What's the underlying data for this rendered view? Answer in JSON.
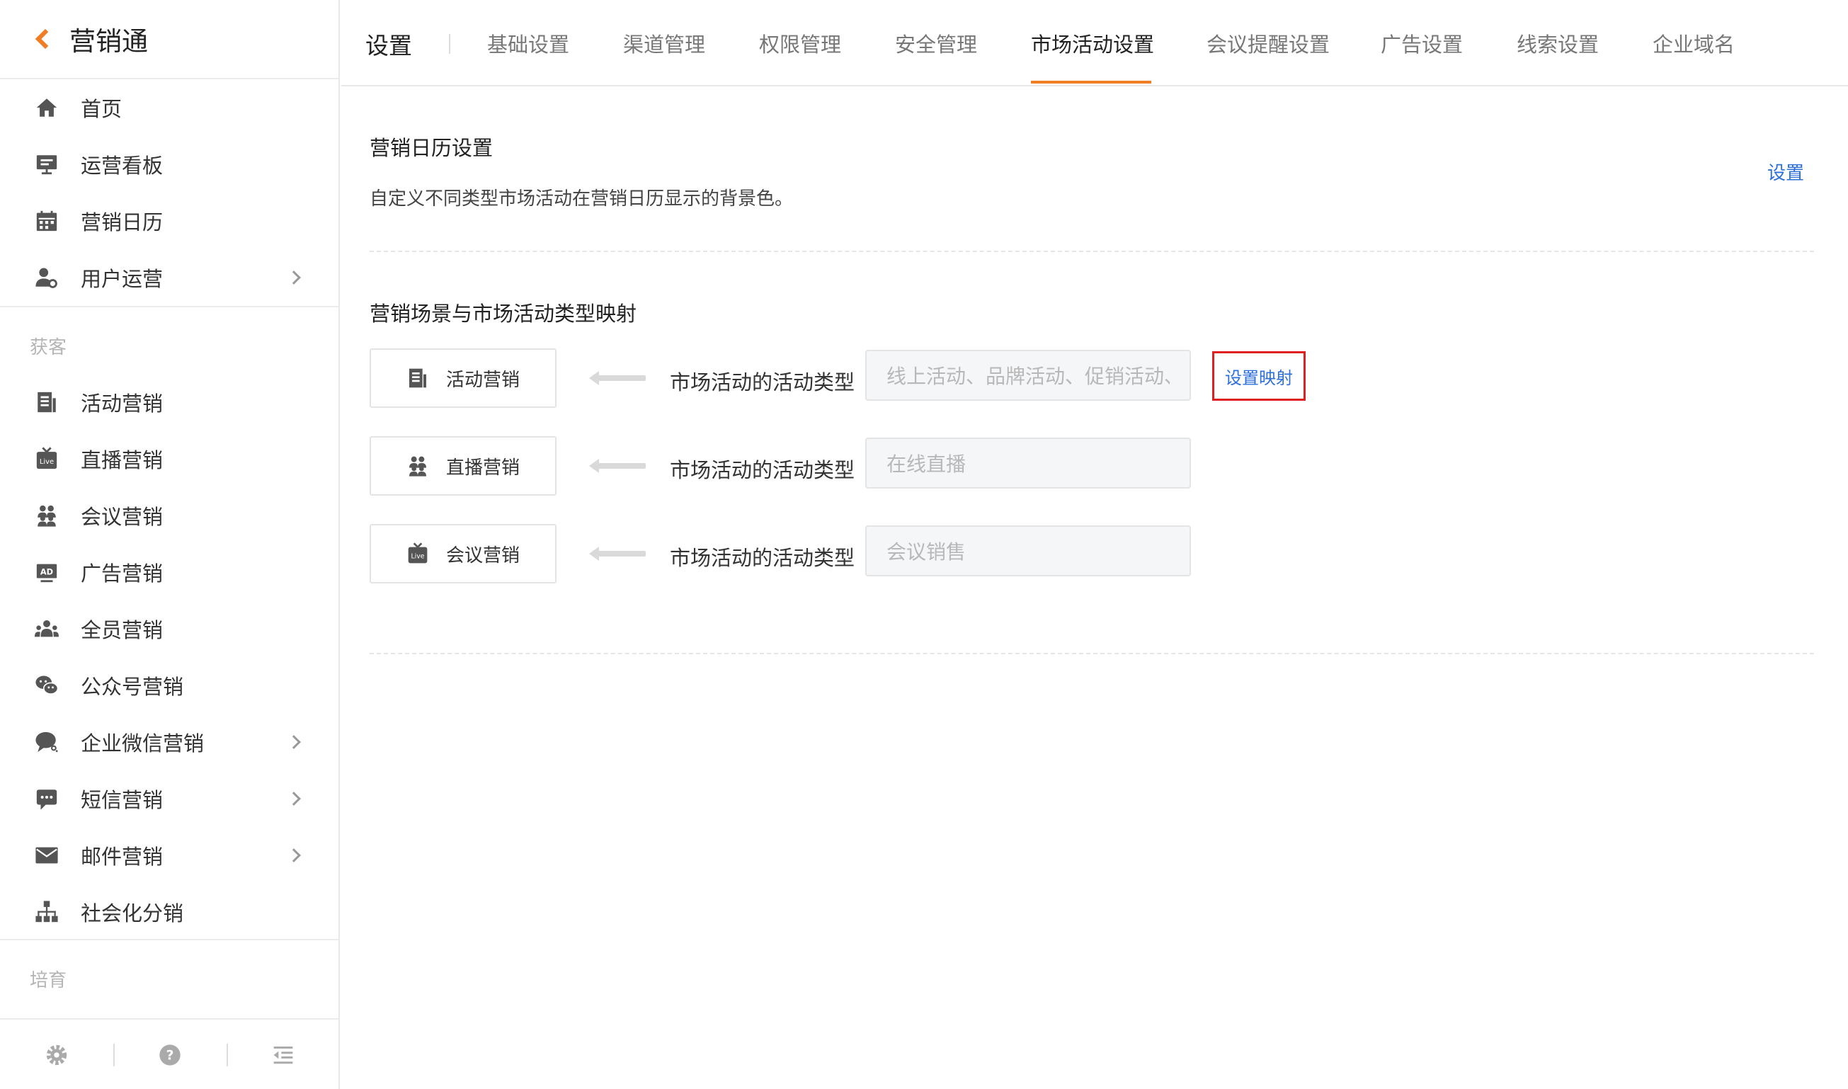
{
  "app": {
    "title": "营销通"
  },
  "sidebar": {
    "top_items": [
      {
        "label": "首页",
        "icon": "home-icon"
      },
      {
        "label": "运营看板",
        "icon": "dashboard-board-icon"
      },
      {
        "label": "营销日历",
        "icon": "calendar-icon"
      },
      {
        "label": "用户运营",
        "icon": "user-settings-icon",
        "has_children": true
      }
    ],
    "section_acquire": "获客",
    "acquire_items": [
      {
        "label": "活动营销",
        "icon": "document-icon"
      },
      {
        "label": "直播营销",
        "icon": "live-icon"
      },
      {
        "label": "会议营销",
        "icon": "people-group-icon"
      },
      {
        "label": "广告营销",
        "icon": "ad-icon"
      },
      {
        "label": "全员营销",
        "icon": "team-icon"
      },
      {
        "label": "公众号营销",
        "icon": "wechat-icon"
      },
      {
        "label": "企业微信营销",
        "icon": "chat-bubble-icon",
        "has_children": true
      },
      {
        "label": "短信营销",
        "icon": "sms-icon",
        "has_children": true
      },
      {
        "label": "邮件营销",
        "icon": "mail-icon",
        "has_children": true
      },
      {
        "label": "社会化分销",
        "icon": "org-tree-icon"
      }
    ],
    "section_nurture": "培育",
    "footer_icons": [
      "gear-icon",
      "help-icon",
      "collapse-menu-icon"
    ]
  },
  "topbar": {
    "title": "设置",
    "tabs": [
      "基础设置",
      "渠道管理",
      "权限管理",
      "安全管理",
      "市场活动设置",
      "会议提醒设置",
      "广告设置",
      "线索设置",
      "企业域名"
    ],
    "active_tab": "市场活动设置"
  },
  "calendar_section": {
    "title": "营销日历设置",
    "description": "自定义不同类型市场活动在营销日历显示的背景色。",
    "action": "设置"
  },
  "mapping_section": {
    "title": "营销场景与市场活动类型映射",
    "rows": [
      {
        "scene": "活动营销",
        "icon": "document-icon",
        "label": "市场活动的活动类型",
        "value": "线上活动、品牌活动、促销活动、"
      },
      {
        "scene": "直播营销",
        "icon": "people-group-icon",
        "label": "市场活动的活动类型",
        "value": "在线直播"
      },
      {
        "scene": "会议营销",
        "icon": "live-icon",
        "label": "市场活动的活动类型",
        "value": "会议销售"
      }
    ],
    "map_button": "设置映射"
  },
  "colors": {
    "accent": "#f07c24",
    "link": "#2d6fdb",
    "highlight_border": "#e02020"
  }
}
